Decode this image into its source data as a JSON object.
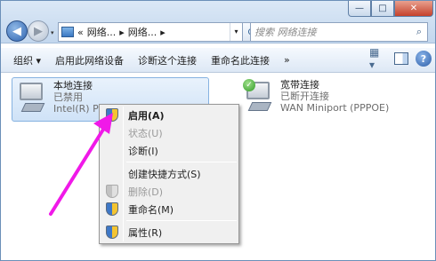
{
  "window": {
    "buttons": {
      "minimize": "—",
      "maximize": "□",
      "close": "✕"
    }
  },
  "nav": {
    "back_icon": "arrow-left-icon",
    "forward_icon": "arrow-right-icon",
    "dropdown": "▾"
  },
  "address": {
    "prefix": "«",
    "segment1": "网络...",
    "sep1": "▸",
    "segment2": "网络...",
    "sep2": "▸",
    "dropdown": "▾"
  },
  "refresh_glyph": "⟳",
  "search": {
    "placeholder": "搜索 网络连接",
    "icon": "⌕"
  },
  "toolbar": {
    "organize": "组织 ▾",
    "enable_device": "启用此网络设备",
    "diagnose": "诊断这个连接",
    "rename": "重命名此连接",
    "more": "»",
    "view_glyph": "▦ ▾",
    "help_glyph": "?"
  },
  "connections": [
    {
      "name": "本地连接",
      "status": "已禁用",
      "device": "Intel(R) P"
    },
    {
      "name": "宽带连接",
      "status": "已断开连接",
      "device": "WAN Miniport (PPPOE)"
    }
  ],
  "context_menu": {
    "items": [
      {
        "label": "启用(A)",
        "bold": true,
        "disabled": false,
        "icon": "shield-icon"
      },
      {
        "label": "状态(U)",
        "bold": false,
        "disabled": true,
        "icon": ""
      },
      {
        "label": "诊断(I)",
        "bold": false,
        "disabled": false,
        "icon": ""
      },
      {
        "label": "创建快捷方式(S)",
        "bold": false,
        "disabled": false,
        "icon": ""
      },
      {
        "label": "删除(D)",
        "bold": false,
        "disabled": true,
        "icon": "shield-icon"
      },
      {
        "label": "重命名(M)",
        "bold": false,
        "disabled": false,
        "icon": "shield-icon"
      },
      {
        "label": "属性(R)",
        "bold": false,
        "disabled": false,
        "icon": "shield-icon"
      }
    ]
  },
  "annotation_color": "#f019e8"
}
